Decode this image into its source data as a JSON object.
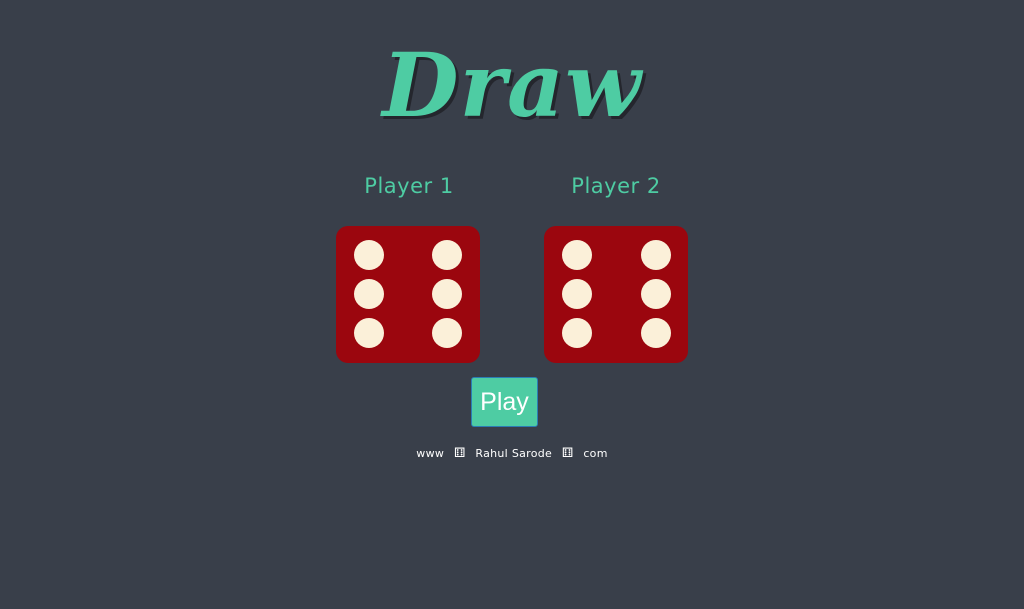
{
  "title": "Draw",
  "players": [
    {
      "label": "Player 1",
      "die_value": 6
    },
    {
      "label": "Player 2",
      "die_value": 6
    }
  ],
  "play_button_label": "Play",
  "footer": {
    "prefix": "www",
    "name": "Rahul Sarode",
    "suffix": "com",
    "separator_icon": "dice-icon"
  },
  "colors": {
    "background": "#393f4a",
    "accent": "#4ecca3",
    "die": "#9b060e",
    "pip": "#fbf0d9"
  }
}
